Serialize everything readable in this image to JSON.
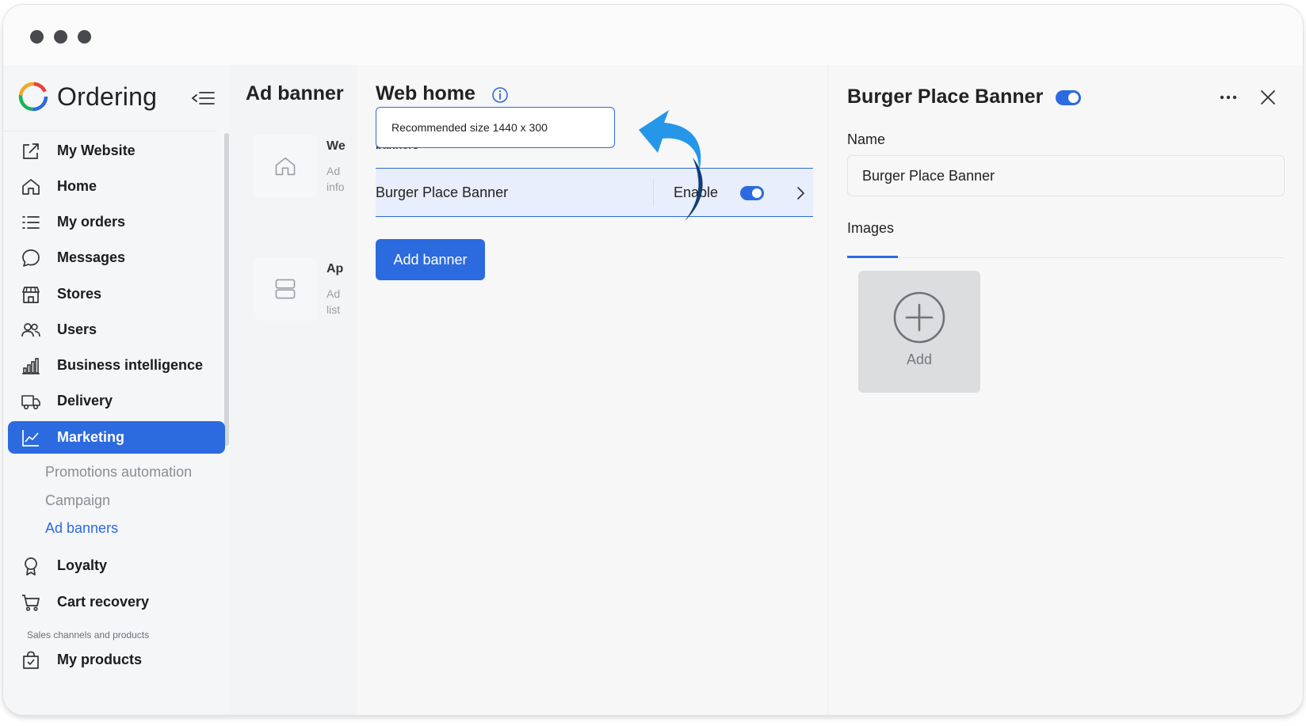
{
  "sidebar": {
    "brand": "Ordering",
    "items": [
      {
        "label": "My Website",
        "icon": "external-link-icon"
      },
      {
        "label": "Home",
        "icon": "home-icon"
      },
      {
        "label": "My orders",
        "icon": "list-icon"
      },
      {
        "label": "Messages",
        "icon": "chat-bubble-icon"
      },
      {
        "label": "Stores",
        "icon": "store-icon"
      },
      {
        "label": "Users",
        "icon": "users-icon"
      },
      {
        "label": "Business intelligence",
        "icon": "bar-chart-icon"
      },
      {
        "label": "Delivery",
        "icon": "truck-icon"
      },
      {
        "label": "Marketing",
        "icon": "line-chart-icon",
        "active": true
      },
      {
        "label": "Loyalty",
        "icon": "award-icon"
      },
      {
        "label": "Cart recovery",
        "icon": "cart-icon"
      },
      {
        "label": "My products",
        "icon": "shopping-bag-icon"
      }
    ],
    "marketing_sub": [
      "Promotions automation",
      "Campaign",
      "Ad banners"
    ],
    "section_label": "Sales channels and products"
  },
  "background_list": {
    "title": "Ad banner",
    "cards": [
      {
        "title": "We",
        "desc_line1": "Ad",
        "desc_line2": "info",
        "icon": "home-icon"
      },
      {
        "title": "Ap",
        "desc_line1": "Ad",
        "desc_line2": "list",
        "icon": "layout-rows-icon"
      }
    ]
  },
  "web_home": {
    "title": "Web home",
    "tooltip": "Recommended size 1440 x 300",
    "banners_label": "banners",
    "banner_row": {
      "name": "Burger Place Banner",
      "status_label": "Enable",
      "enabled": true
    },
    "add_button": "Add banner"
  },
  "detail": {
    "title": "Burger Place Banner",
    "enabled": true,
    "name_label": "Name",
    "name_value": "Burger Place Banner",
    "tab_images": "Images",
    "add_image_label": "Add"
  },
  "colors": {
    "accent": "#2c6adf",
    "arrow": "#2596e8",
    "arrow_dark": "#123e72"
  }
}
